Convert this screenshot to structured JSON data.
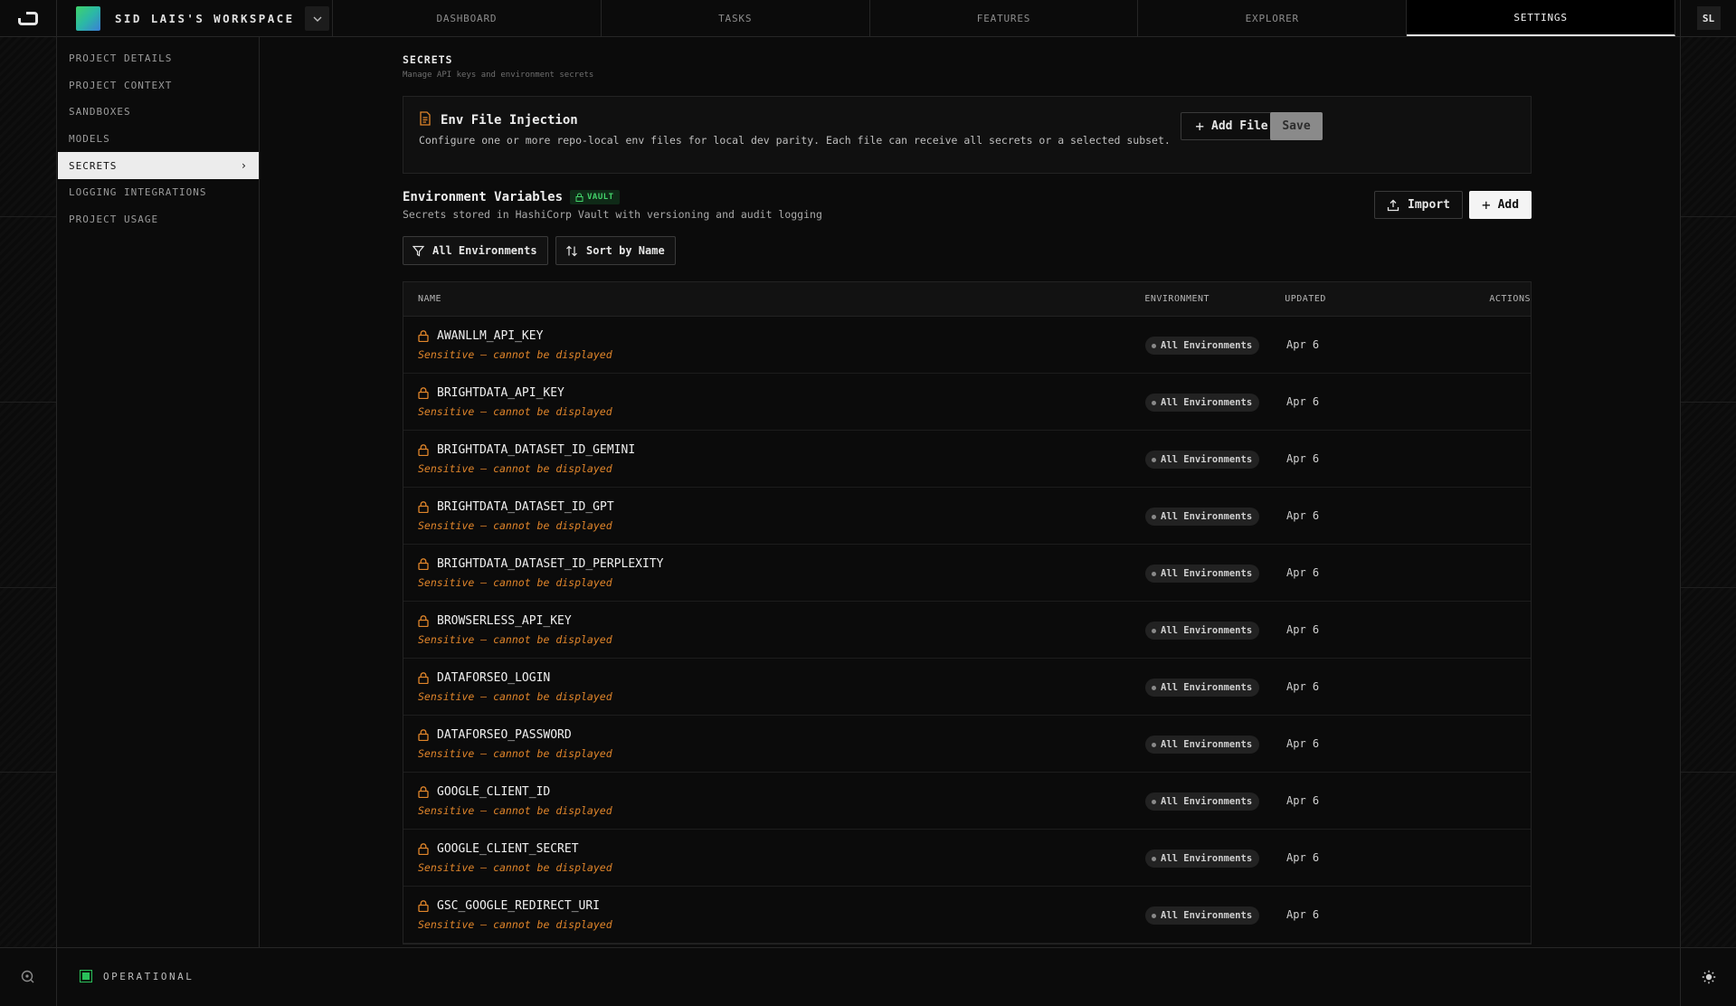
{
  "workspace": {
    "name": "SID LAIS'S WORKSPACE"
  },
  "nav": {
    "tabs": [
      {
        "label": "DASHBOARD"
      },
      {
        "label": "TASKS"
      },
      {
        "label": "FEATURES"
      },
      {
        "label": "EXPLORER"
      },
      {
        "label": "SETTINGS",
        "active": true
      }
    ]
  },
  "user": {
    "initials": "SL"
  },
  "sidebar": {
    "items": [
      {
        "label": "PROJECT DETAILS"
      },
      {
        "label": "PROJECT CONTEXT"
      },
      {
        "label": "SANDBOXES"
      },
      {
        "label": "MODELS"
      },
      {
        "label": "SECRETS",
        "active": true
      },
      {
        "label": "LOGGING INTEGRATIONS"
      },
      {
        "label": "PROJECT USAGE"
      }
    ]
  },
  "page": {
    "title": "SECRETS",
    "subtitle": "Manage API keys and environment secrets"
  },
  "env_file": {
    "title": "Env File Injection",
    "description": "Configure one or more repo-local env files for local dev parity. Each file can receive all secrets or a selected subset.",
    "add_file_label": "Add File",
    "save_label": "Save"
  },
  "env_vars": {
    "title": "Environment Variables",
    "badge": "VAULT",
    "subtitle": "Secrets stored in HashiCorp Vault with versioning and audit logging",
    "import_label": "Import",
    "add_label": "Add",
    "filter_label": "All Environments",
    "sort_label": "Sort by Name"
  },
  "table": {
    "headers": {
      "name": "NAME",
      "environment": "ENVIRONMENT",
      "updated": "UPDATED",
      "actions": "ACTIONS"
    },
    "sensitive_text": "Sensitive — cannot be displayed",
    "rows": [
      {
        "name": "AWANLLM_API_KEY",
        "environment": "All Environments",
        "updated": "Apr 6"
      },
      {
        "name": "BRIGHTDATA_API_KEY",
        "environment": "All Environments",
        "updated": "Apr 6"
      },
      {
        "name": "BRIGHTDATA_DATASET_ID_GEMINI",
        "environment": "All Environments",
        "updated": "Apr 6"
      },
      {
        "name": "BRIGHTDATA_DATASET_ID_GPT",
        "environment": "All Environments",
        "updated": "Apr 6"
      },
      {
        "name": "BRIGHTDATA_DATASET_ID_PERPLEXITY",
        "environment": "All Environments",
        "updated": "Apr 6"
      },
      {
        "name": "BROWSERLESS_API_KEY",
        "environment": "All Environments",
        "updated": "Apr 6"
      },
      {
        "name": "DATAFORSEO_LOGIN",
        "environment": "All Environments",
        "updated": "Apr 6"
      },
      {
        "name": "DATAFORSEO_PASSWORD",
        "environment": "All Environments",
        "updated": "Apr 6"
      },
      {
        "name": "GOOGLE_CLIENT_ID",
        "environment": "All Environments",
        "updated": "Apr 6"
      },
      {
        "name": "GOOGLE_CLIENT_SECRET",
        "environment": "All Environments",
        "updated": "Apr 6"
      },
      {
        "name": "GSC_GOOGLE_REDIRECT_URI",
        "environment": "All Environments",
        "updated": "Apr 6"
      }
    ]
  },
  "footer": {
    "status": "OPERATIONAL"
  },
  "colors": {
    "accent_green": "#43d36a",
    "sensitive_orange": "#e0852a",
    "status_green": "#2ac05a"
  },
  "icons": [
    "logo-icon",
    "chevron-down-icon",
    "file-text-icon",
    "plus-icon",
    "upload-icon",
    "filter-icon",
    "sort-icon",
    "lock-icon",
    "chevron-right-icon",
    "help-icon",
    "sun-icon"
  ]
}
